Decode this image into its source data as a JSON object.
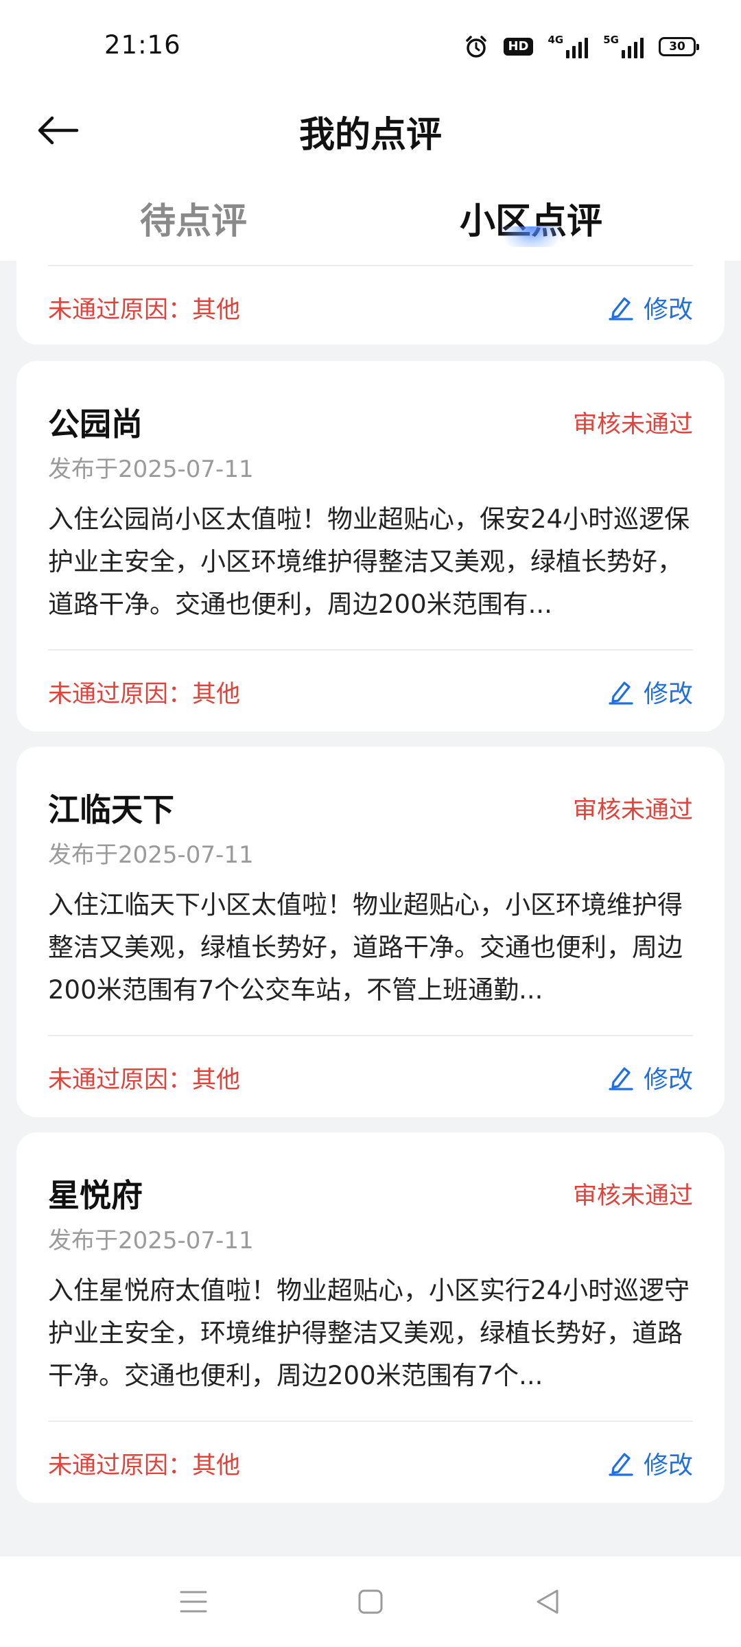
{
  "status_bar": {
    "time": "21:16",
    "icons": [
      "alarm-icon",
      "hd-icon",
      "4g-signal-icon",
      "5g-signal-icon",
      "battery-icon"
    ],
    "hd_label": "HD",
    "net1_label": "4G",
    "net2_label": "5G",
    "battery_level": "30"
  },
  "header": {
    "title": "我的点评",
    "tabs": [
      {
        "label": "待点评",
        "active": false
      },
      {
        "label": "小区点评",
        "active": true
      }
    ]
  },
  "partial_card": {
    "reject_reason": "未通过原因：其他",
    "edit_label": "修改"
  },
  "cards": [
    {
      "name": "公园尚",
      "status": "审核未通过",
      "date": "发布于2025-07-11",
      "text": "入住公园尚小区太值啦！物业超贴心，保安24小时巡逻保护业主安全，小区环境维护得整洁又美观，绿植长势好，道路干净。交通也便利，周边200米范围有...",
      "reject_reason": "未通过原因：其他",
      "edit_label": "修改"
    },
    {
      "name": "江临天下",
      "status": "审核未通过",
      "date": "发布于2025-07-11",
      "text": "入住江临天下小区太值啦！物业超贴心，小区环境维护得整洁又美观，绿植长势好，道路干净。交通也便利，周边200米范围有7个公交车站，不管上班通勤...",
      "reject_reason": "未通过原因：其他",
      "edit_label": "修改"
    },
    {
      "name": "星悦府",
      "status": "审核未通过",
      "date": "发布于2025-07-11",
      "text": "入住星悦府太值啦！物业超贴心，小区实行24小时巡逻守护业主安全，环境维护得整洁又美观，绿植长势好，道路干净。交通也便利，周边200米范围有7个...",
      "reject_reason": "未通过原因：其他",
      "edit_label": "修改"
    }
  ],
  "colors": {
    "reject_red": "#e0433b",
    "edit_blue": "#1f6fe0",
    "background": "#f2f3f5"
  },
  "nav_bar": {
    "icons": [
      "menu-icon",
      "home-square-icon",
      "back-triangle-icon"
    ]
  }
}
